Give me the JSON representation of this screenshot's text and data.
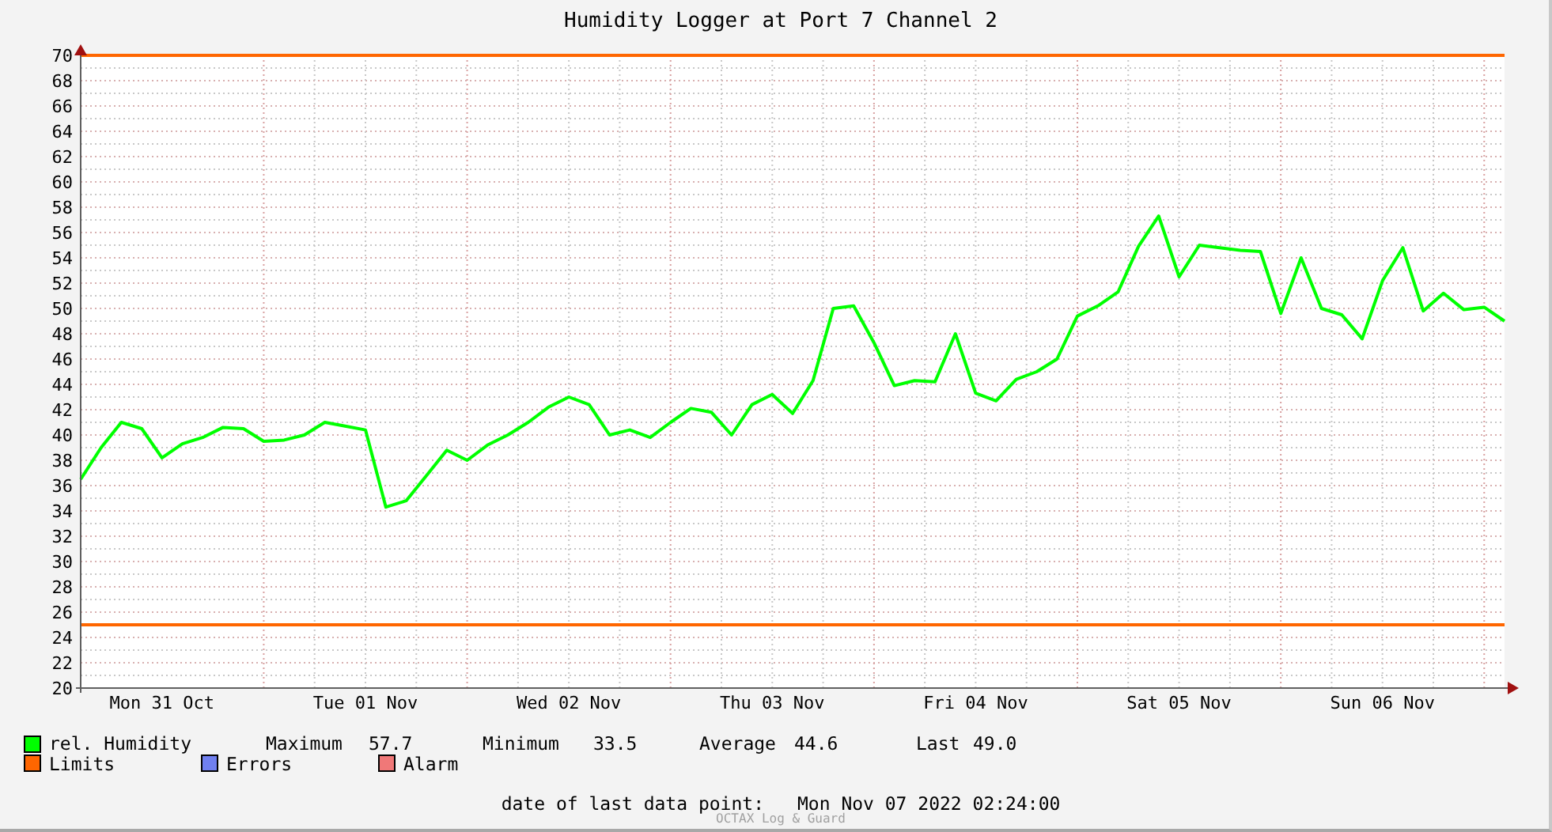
{
  "graph": {
    "chart_data": {
      "type": "line",
      "title": "Humidity Logger at Port 7 Channel 2",
      "ylim": [
        20,
        70
      ],
      "grid": true,
      "yticks": [
        20,
        22,
        24,
        26,
        28,
        30,
        32,
        34,
        36,
        38,
        40,
        42,
        44,
        46,
        48,
        50,
        52,
        54,
        56,
        58,
        60,
        62,
        64,
        66,
        68,
        70
      ],
      "categories": [
        null,
        null,
        null,
        null,
        "Mon 31 Oct",
        null,
        null,
        null,
        null,
        null,
        null,
        null,
        null,
        null,
        "Tue 01 Nov",
        null,
        null,
        null,
        null,
        null,
        null,
        null,
        null,
        null,
        "Wed 02 Nov",
        null,
        null,
        null,
        null,
        null,
        null,
        null,
        null,
        null,
        "Thu 03 Nov",
        null,
        null,
        null,
        null,
        null,
        null,
        null,
        null,
        null,
        "Fri 04 Nov",
        null,
        null,
        null,
        null,
        null,
        null,
        null,
        null,
        null,
        "Sat 05 Nov",
        null,
        null,
        null,
        null,
        null,
        null,
        null,
        null,
        null,
        "Sun 06 Nov",
        null,
        null,
        null,
        null,
        null,
        null
      ],
      "series": [
        {
          "name": "rel. Humidity",
          "color": "#00ff00",
          "values": [
            36.5,
            39,
            41,
            40.5,
            38.2,
            39.3,
            39.8,
            40.6,
            40.5,
            39.5,
            39.6,
            40,
            41,
            40.7,
            40.4,
            34.3,
            34.8,
            36.8,
            38.8,
            38,
            39.2,
            40,
            41,
            42.2,
            43,
            42.4,
            40,
            40.4,
            39.8,
            41,
            42.1,
            41.8,
            40,
            42.4,
            43.2,
            41.7,
            44.3,
            50,
            50.2,
            47.3,
            43.9,
            44.3,
            44.2,
            48,
            43.3,
            42.7,
            44.4,
            45,
            46,
            49.4,
            50.2,
            51.3,
            54.9,
            57.3,
            52.5,
            55,
            54.8,
            54.6,
            54.5,
            49.6,
            54,
            50,
            49.5,
            47.6,
            52.2,
            54.8,
            49.8,
            51.2,
            49.9,
            50.1,
            49
          ]
        },
        {
          "name": "Limits",
          "color": "#ff6600",
          "values": [
            70,
            70,
            70,
            70,
            70,
            70,
            70,
            70,
            70,
            70,
            70,
            70,
            70,
            70,
            70,
            70,
            70,
            70,
            70,
            70,
            70,
            70,
            70,
            70,
            70,
            70,
            70,
            70,
            70,
            70,
            70,
            70,
            70,
            70,
            70,
            70,
            70,
            70,
            70,
            70,
            70,
            70,
            70,
            70,
            70,
            70,
            70,
            70,
            70,
            70,
            70,
            70,
            70,
            70,
            70,
            70,
            70,
            70,
            70,
            70,
            70,
            70,
            70,
            70,
            70,
            70,
            70,
            70,
            70,
            70,
            70
          ]
        },
        {
          "color": "#ff6600",
          "values": [
            25,
            25,
            25,
            25,
            25,
            25,
            25,
            25,
            25,
            25,
            25,
            25,
            25,
            25,
            25,
            25,
            25,
            25,
            25,
            25,
            25,
            25,
            25,
            25,
            25,
            25,
            25,
            25,
            25,
            25,
            25,
            25,
            25,
            25,
            25,
            25,
            25,
            25,
            25,
            25,
            25,
            25,
            25,
            25,
            25,
            25,
            25,
            25,
            25,
            25,
            25,
            25,
            25,
            25,
            25,
            25,
            25,
            25,
            25,
            25,
            25,
            25,
            25,
            25,
            25,
            25,
            25,
            25,
            25,
            25,
            25
          ]
        }
      ]
    }
  },
  "legend": [
    {
      "label": "Errors",
      "color": "#7080f0"
    },
    {
      "label": "Alarm",
      "color": "#f07878"
    }
  ],
  "stats": [
    {
      "label": "Maximum",
      "value": "57.7"
    },
    {
      "label": "Minimum",
      "value": "33.5"
    },
    {
      "label": "Average",
      "value": "44.6"
    },
    {
      "label": "Last",
      "value": "49.0"
    }
  ],
  "last_data_point": {
    "label": "date of last data point:",
    "value": "Mon Nov 07 2022 02:24:00"
  },
  "credit": "OCTAX Log & Guard"
}
